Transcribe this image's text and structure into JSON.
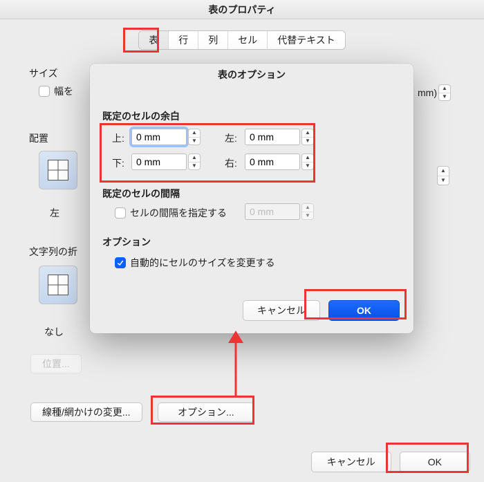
{
  "main": {
    "title": "表のプロパティ",
    "tabs": [
      {
        "key": "table",
        "label": "表",
        "selected": true
      },
      {
        "key": "row",
        "label": "行",
        "selected": false
      },
      {
        "key": "column",
        "label": "列",
        "selected": false
      },
      {
        "key": "cell",
        "label": "セル",
        "selected": false
      },
      {
        "key": "alttext",
        "label": "代替テキスト",
        "selected": false
      }
    ],
    "sections": {
      "size": {
        "label": "サイズ",
        "width_checkbox_label": "幅を",
        "unit_hint": "mm)"
      },
      "align": {
        "label": "配置",
        "left_label": "左"
      },
      "textwrap": {
        "label": "文字列の折",
        "none_label": "なし"
      }
    },
    "buttons": {
      "position": "位置...",
      "borders_shading": "線種/網かけの変更...",
      "options": "オプション...",
      "cancel": "キャンセル",
      "ok": "OK"
    }
  },
  "modal": {
    "title": "表のオプション",
    "default_margins": {
      "label": "既定のセルの余白",
      "top": {
        "label": "上:",
        "value": "0 mm"
      },
      "bottom": {
        "label": "下:",
        "value": "0 mm"
      },
      "left": {
        "label": "左:",
        "value": "0 mm"
      },
      "right": {
        "label": "右:",
        "value": "0 mm"
      }
    },
    "default_spacing": {
      "label": "既定のセルの間隔",
      "checkbox": "セルの間隔を指定する",
      "value": "0 mm"
    },
    "options": {
      "label": "オプション",
      "auto_resize": "自動的にセルのサイズを変更する"
    },
    "buttons": {
      "cancel": "キャンセル",
      "ok": "OK"
    }
  }
}
